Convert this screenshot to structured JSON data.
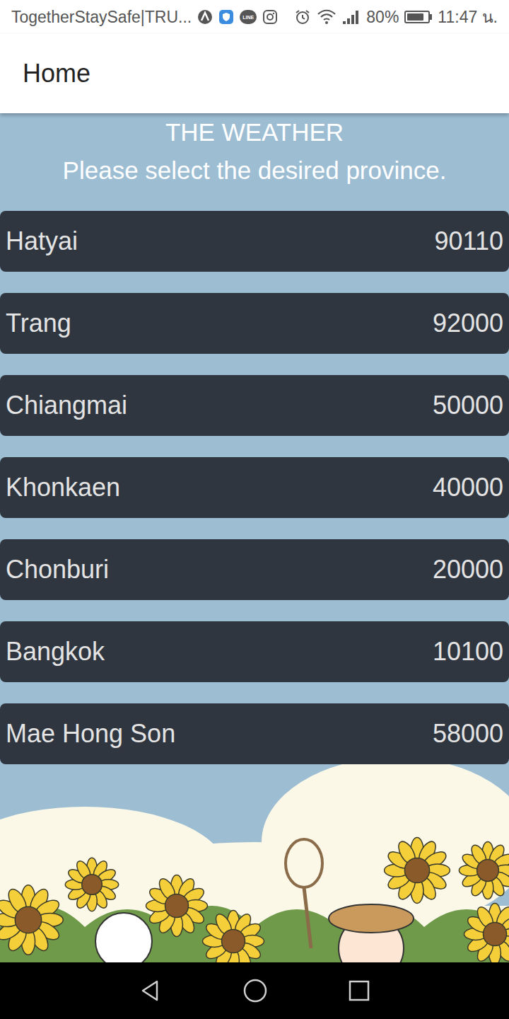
{
  "status_bar": {
    "carrier_text": "TogetherStaySafe|TRU...",
    "line_icon_label": "LINE",
    "battery": "80%",
    "battery_level": 0.8,
    "time": "11:47 น."
  },
  "app_bar": {
    "title": "Home"
  },
  "header": {
    "title": "THE WEATHER",
    "subtitle": "Please select the desired province."
  },
  "provinces": [
    {
      "name": "Hatyai",
      "code": "90110"
    },
    {
      "name": "Trang",
      "code": "92000"
    },
    {
      "name": "Chiangmai",
      "code": "50000"
    },
    {
      "name": "Khonkaen",
      "code": "40000"
    },
    {
      "name": "Chonburi",
      "code": "20000"
    },
    {
      "name": "Bangkok",
      "code": "10100"
    },
    {
      "name": "Mae Hong Son",
      "code": "58000"
    }
  ]
}
